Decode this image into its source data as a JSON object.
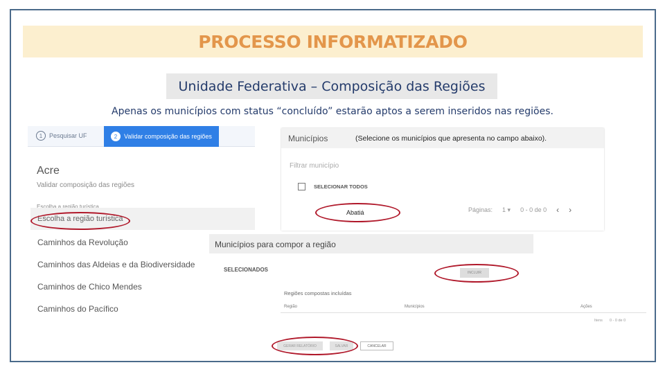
{
  "slide": {
    "title": "PROCESSO INFORMATIZADO",
    "subtitle": "Unidade Federativa – Composição das Regiões",
    "note": "Apenas os municípios com status “concluído” estarão aptos a serem inseridos nas regiões."
  },
  "stepper": {
    "step1_num": "1",
    "step1_label": "Pesquisar UF",
    "step2_num": "2",
    "step2_label": "Validar composição das regiões"
  },
  "uf": {
    "name": "Acre",
    "description": "Validar composição das regiões"
  },
  "region_select": {
    "label": "Escolha a região turística",
    "selected": "Escolha a região turística",
    "options": [
      "Caminhos da Revolução",
      "Caminhos das Aldeias e da Biodiversidade",
      "Caminhos de Chico Mendes",
      "Caminhos do Pacífico"
    ]
  },
  "municipios": {
    "header": "Municípios",
    "hint": "(Selecione os municípios que apresenta no campo abaixo).",
    "filter_placeholder": "Filtrar município",
    "select_all": "SELECIONAR TODOS",
    "items": [
      "Abatiá"
    ],
    "pager": {
      "label": "Páginas:",
      "page": "1",
      "range": "0 - 0 de 0",
      "prev": "‹",
      "next": "›"
    }
  },
  "composition": {
    "header": "Municípios para compor a região",
    "selected_label": "SELECIONADOS",
    "include_button": "INCLUIR",
    "regions_title": "Regiões compostas incluídas",
    "columns": [
      "Região",
      "Municípios",
      "Ações"
    ],
    "pager": {
      "label": "Itens",
      "range": "0 - 0 de 0"
    }
  },
  "actions": {
    "save_selection": "GERAR RELATÓRIO",
    "save": "SALVAR",
    "cancel": "CANCELAR"
  },
  "colors": {
    "title": "#e3964b",
    "title_bg": "#fcefcf",
    "subtitle_text": "#243b6b",
    "accent": "#2f7fe6",
    "highlight": "#b0182a"
  }
}
